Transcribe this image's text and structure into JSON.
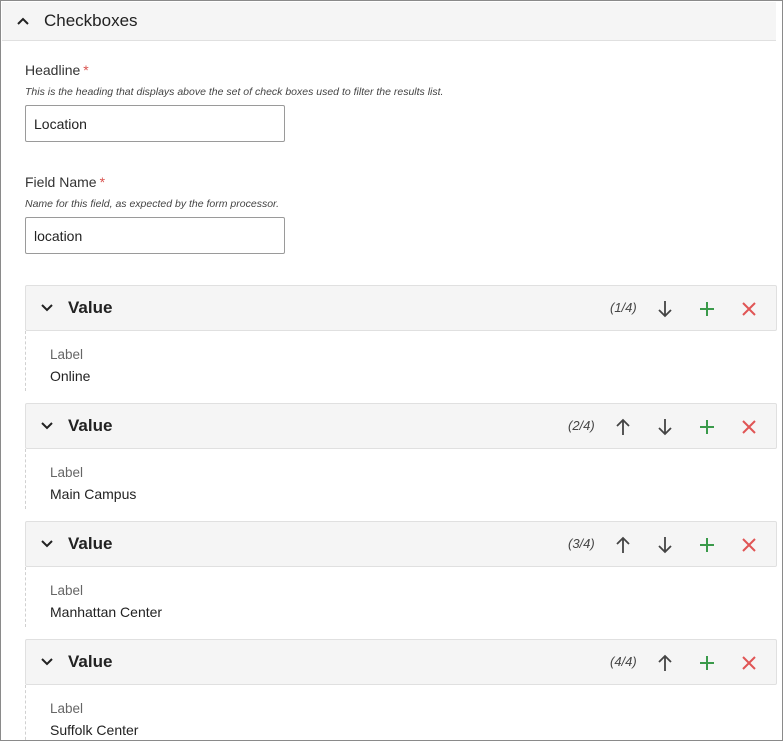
{
  "section": {
    "title": "Checkboxes"
  },
  "headline": {
    "label": "Headline",
    "required_mark": "*",
    "help": "This is the heading that displays above the set of check boxes used to filter the results list.",
    "value": "Location"
  },
  "field_name": {
    "label": "Field Name",
    "required_mark": "*",
    "help": "Name for this field, as expected by the form processor.",
    "value": "location"
  },
  "values": [
    {
      "title": "Value",
      "counter": "(1/4)",
      "label_caption": "Label",
      "label_value": "Online"
    },
    {
      "title": "Value",
      "counter": "(2/4)",
      "label_caption": "Label",
      "label_value": "Main Campus"
    },
    {
      "title": "Value",
      "counter": "(3/4)",
      "label_caption": "Label",
      "label_value": "Manhattan Center"
    },
    {
      "title": "Value",
      "counter": "(4/4)",
      "label_caption": "Label",
      "label_value": "Suffolk Center"
    }
  ],
  "colors": {
    "add": "#3a9a4a",
    "remove": "#e05555",
    "arrow": "#444444",
    "required": "#d9534f"
  },
  "icons": {
    "section_toggle": "chevron-up-icon",
    "value_toggle": "chevron-down-icon",
    "move_up": "arrow-up-icon",
    "move_down": "arrow-down-icon",
    "add": "plus-icon",
    "remove": "close-icon"
  }
}
